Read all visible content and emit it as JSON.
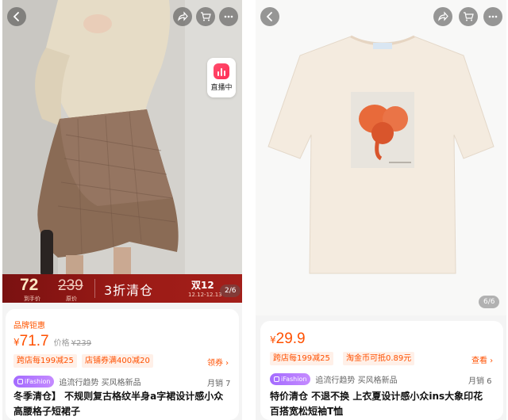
{
  "left": {
    "live_label": "直播中",
    "promo": {
      "price": "72",
      "price_label": "到手价",
      "original": "239",
      "original_label": "原价",
      "text": "3折清仓",
      "event": "双12",
      "dates": "12.12-12.13"
    },
    "image_counter": "2/6",
    "card": {
      "brand_tag": "品牌钜惠",
      "currency": "¥",
      "price": "71.7",
      "price_label": "价格",
      "original_price": "¥239",
      "coupons": [
        "跨店每199减25",
        "店铺券满400减20"
      ],
      "coupon_link": "领券 ›",
      "ifashion": "iFashion",
      "tags": "追流行趋势 买风格新品",
      "sales": "月销 7",
      "title_line1": "冬季清仓】 不规则复古格纹半身a字裙设计感小众",
      "title_line2": "高腰格子短裙子"
    }
  },
  "right": {
    "image_counter": "6/6",
    "card": {
      "currency": "¥",
      "price": "29.9",
      "coupons": [
        "跨店每199减25",
        "淘金币可抵0.89元"
      ],
      "coupon_link": "查看 ›",
      "ifashion": "iFashion",
      "tags": "追流行趋势 买风格新品",
      "sales": "月销 6",
      "title_line1": "特价清仓 不退不换 上衣夏设计感小众ins大象印花",
      "title_line2": "百搭宽松短袖T恤"
    }
  },
  "icons": [
    "back-icon",
    "share-icon",
    "cart-icon",
    "more-icon",
    "live-icon"
  ],
  "colors": {
    "accent": "#ff5000",
    "promo_bar": "#9c1b16",
    "ifashion": "#b07cff"
  }
}
